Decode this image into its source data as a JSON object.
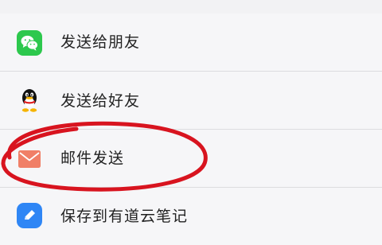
{
  "share_menu": {
    "items": [
      {
        "label": "发送给朋友",
        "icon": "wechat-icon",
        "color": "#2dc84d"
      },
      {
        "label": "发送给好友",
        "icon": "qq-penguin-icon",
        "color": "#111111"
      },
      {
        "label": "邮件发送",
        "icon": "mail-envelope-icon",
        "color": "#f07f67"
      },
      {
        "label": "保存到有道云笔记",
        "icon": "youdao-note-icon",
        "color": "#2f86f5"
      }
    ]
  },
  "annotation": {
    "color": "#d8141f"
  }
}
